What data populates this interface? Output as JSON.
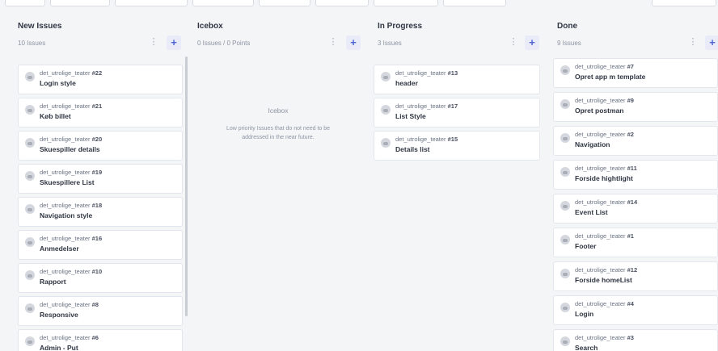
{
  "columns": [
    {
      "title": "New Issues",
      "meta": "10 Issues",
      "cards": [
        {
          "repo": "det_utrolige_teater",
          "num": "#22",
          "title": "Login style"
        },
        {
          "repo": "det_utrolige_teater",
          "num": "#21",
          "title": "Køb billet"
        },
        {
          "repo": "det_utrolige_teater",
          "num": "#20",
          "title": "Skuespiller details"
        },
        {
          "repo": "det_utrolige_teater",
          "num": "#19",
          "title": "Skuespillere List"
        },
        {
          "repo": "det_utrolige_teater",
          "num": "#18",
          "title": "Navigation style"
        },
        {
          "repo": "det_utrolige_teater",
          "num": "#16",
          "title": "Anmedelser"
        },
        {
          "repo": "det_utrolige_teater",
          "num": "#10",
          "title": "Rapport"
        },
        {
          "repo": "det_utrolige_teater",
          "num": "#8",
          "title": "Responsive"
        },
        {
          "repo": "det_utrolige_teater",
          "num": "#6",
          "title": "Admin - Put"
        }
      ]
    },
    {
      "title": "Icebox",
      "meta": "0 Issues / 0 Points",
      "empty_title": "Icebox",
      "empty_desc_1": "Low priority Issues that do not need to be",
      "empty_desc_2": "addressed in the near future.",
      "cards": []
    },
    {
      "title": "In Progress",
      "meta": "3 Issues",
      "cards": [
        {
          "repo": "det_utrolige_teater",
          "num": "#13",
          "title": "header"
        },
        {
          "repo": "det_utrolige_teater",
          "num": "#17",
          "title": "List Style"
        },
        {
          "repo": "det_utrolige_teater",
          "num": "#15",
          "title": "Details list"
        }
      ]
    },
    {
      "title": "Done",
      "meta": "9 Issues",
      "cards": [
        {
          "repo": "det_utrolige_teater",
          "num": "#7",
          "title": "Opret app m template"
        },
        {
          "repo": "det_utrolige_teater",
          "num": "#9",
          "title": "Opret postman"
        },
        {
          "repo": "det_utrolige_teater",
          "num": "#2",
          "title": "Navigation"
        },
        {
          "repo": "det_utrolige_teater",
          "num": "#11",
          "title": "Forside hightlight"
        },
        {
          "repo": "det_utrolige_teater",
          "num": "#14",
          "title": "Event List"
        },
        {
          "repo": "det_utrolige_teater",
          "num": "#1",
          "title": "Footer"
        },
        {
          "repo": "det_utrolige_teater",
          "num": "#12",
          "title": "Forside homeList"
        },
        {
          "repo": "det_utrolige_teater",
          "num": "#4",
          "title": "Login"
        },
        {
          "repo": "det_utrolige_teater",
          "num": "#3",
          "title": "Search"
        }
      ]
    }
  ],
  "icons": {
    "more": "⋮",
    "add": "+"
  }
}
